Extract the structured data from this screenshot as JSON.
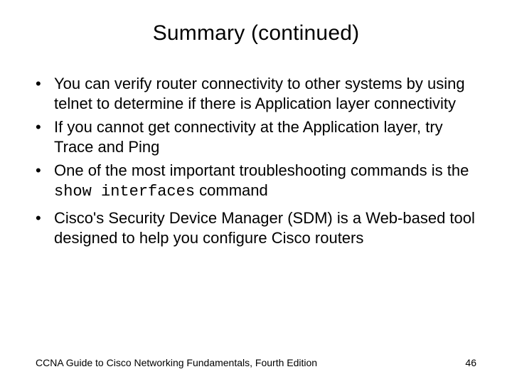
{
  "title": "Summary (continued)",
  "bullets": [
    {
      "parts": [
        {
          "text": "You can verify router connectivity to other systems by using telnet to determine if there is Application layer connectivity",
          "mono": false
        }
      ]
    },
    {
      "parts": [
        {
          "text": "If you cannot get connectivity at the Application layer, try Trace and Ping",
          "mono": false
        }
      ]
    },
    {
      "parts": [
        {
          "text": "One of the most important troubleshooting commands is the ",
          "mono": false
        },
        {
          "text": "show interfaces",
          "mono": true
        },
        {
          "text": " command",
          "mono": false
        }
      ]
    },
    {
      "spaced": true,
      "parts": [
        {
          "text": "Cisco's Security Device Manager (SDM) is a Web-based tool designed to help you configure Cisco routers",
          "mono": false
        }
      ]
    }
  ],
  "footer": {
    "text": "CCNA Guide to Cisco Networking Fundamentals, Fourth Edition",
    "page": "46"
  }
}
